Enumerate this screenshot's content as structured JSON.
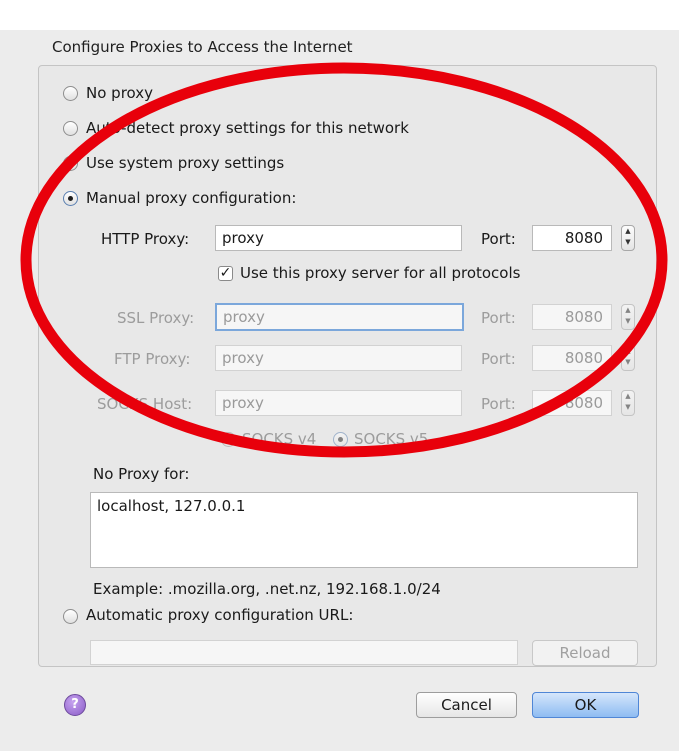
{
  "dialog": {
    "caption": "Configure Proxies to Access the Internet",
    "options": {
      "no_proxy": "No proxy",
      "auto_detect": "Auto-detect proxy settings for this network",
      "system": "Use system proxy settings",
      "manual": "Manual proxy configuration:",
      "auto_url": "Automatic proxy configuration URL:"
    },
    "selected_option": "manual",
    "http": {
      "label": "HTTP Proxy:",
      "value": "proxy",
      "port_label": "Port:",
      "port": "8080"
    },
    "share_checkbox": {
      "label": "Use this proxy server for all protocols",
      "checked": true
    },
    "ssl": {
      "label": "SSL Proxy:",
      "value": "proxy",
      "port_label": "Port:",
      "port": "8080"
    },
    "ftp": {
      "label": "FTP Proxy:",
      "value": "proxy",
      "port_label": "Port:",
      "port": "8080"
    },
    "socks": {
      "label": "SOCKS Host:",
      "value": "proxy",
      "port_label": "Port:",
      "port": "8080"
    },
    "socks_v4": "SOCKS v4",
    "socks_v5": "SOCKS v5",
    "no_proxy_for": {
      "label": "No Proxy for:",
      "value": "localhost, 127.0.0.1"
    },
    "example": "Example: .mozilla.org, .net.nz, 192.168.1.0/24",
    "auto_url_value": "",
    "reload_label": "Reload",
    "help_glyph": "?",
    "cancel_label": "Cancel",
    "ok_label": "OK"
  },
  "annotation": {
    "color": "#e8000b",
    "icon": "red-ellipse-highlight"
  }
}
